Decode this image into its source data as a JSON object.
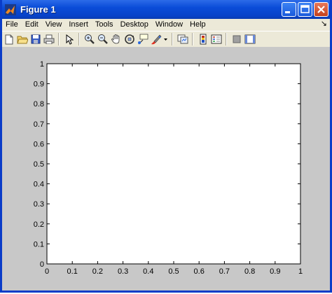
{
  "window": {
    "title": "Figure 1"
  },
  "menu": {
    "items": [
      "File",
      "Edit",
      "View",
      "Insert",
      "Tools",
      "Desktop",
      "Window",
      "Help"
    ],
    "dock_glyph": "↘"
  },
  "toolbar": {
    "buttons": [
      "new-figure-icon",
      "open-file-icon",
      "save-icon",
      "print-icon",
      "edit-plot-arrow-icon",
      "zoom-in-icon",
      "zoom-out-icon",
      "pan-hand-icon",
      "rotate-3d-icon",
      "data-cursor-icon",
      "brush-icon",
      "link-plot-icon",
      "colorbar-icon",
      "legend-icon",
      "hide-plot-tools-icon",
      "show-plot-tools-icon"
    ]
  },
  "colors": {
    "title_bar": "#0a4cd8",
    "figure_background": "#c8c8c8",
    "axes_background": "#ffffff"
  },
  "chart_data": {
    "type": "line",
    "title": "",
    "xlabel": "",
    "ylabel": "",
    "xlim": [
      0,
      1
    ],
    "ylim": [
      0,
      1
    ],
    "xticks": [
      "0",
      "0.1",
      "0.2",
      "0.3",
      "0.4",
      "0.5",
      "0.6",
      "0.7",
      "0.8",
      "0.9",
      "1"
    ],
    "yticks": [
      "0",
      "0.1",
      "0.2",
      "0.3",
      "0.4",
      "0.5",
      "0.6",
      "0.7",
      "0.8",
      "0.9",
      "1"
    ],
    "series": [],
    "grid": false
  }
}
